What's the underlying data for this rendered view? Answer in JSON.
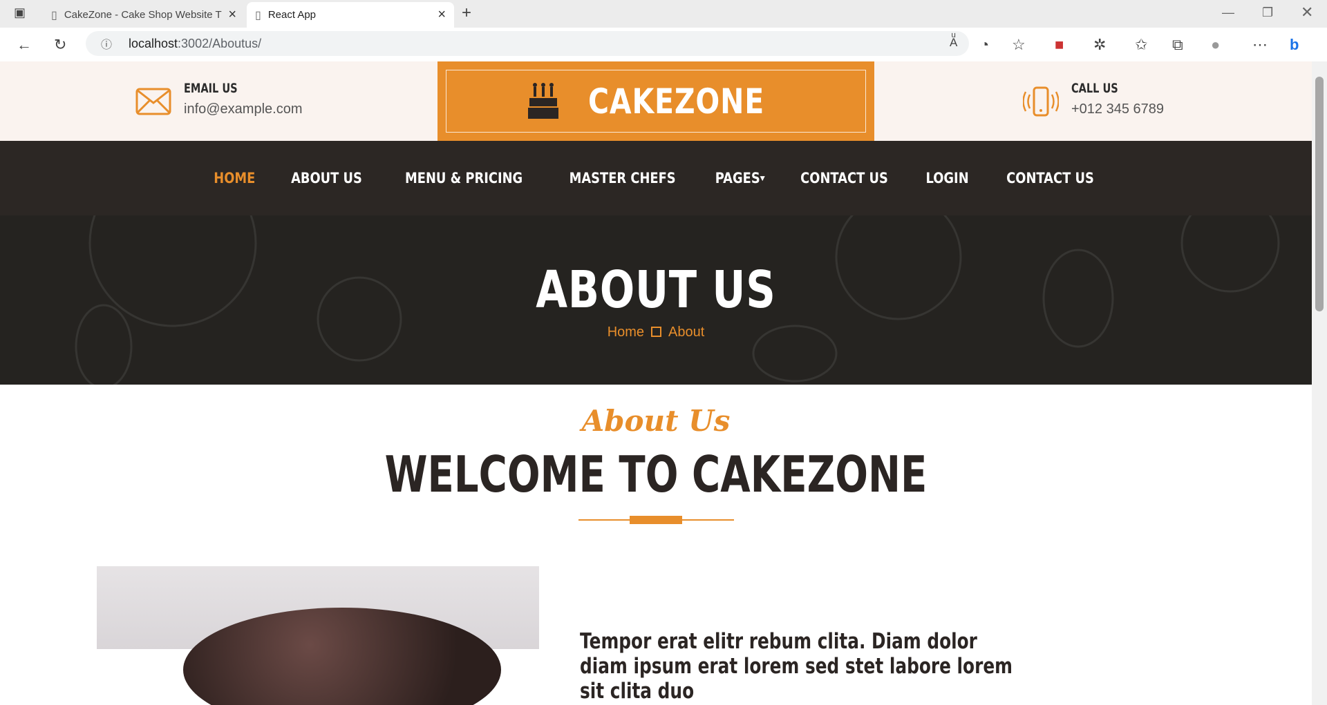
{
  "browser": {
    "tabs": [
      {
        "title": "CakeZone - Cake Shop Website T"
      },
      {
        "title": "React App"
      }
    ],
    "url_host": "localhost",
    "url_path": ":3002/Aboutus/"
  },
  "topbar": {
    "email_label": "EMAIL US",
    "email_value": "info@example.com",
    "call_label": "CALL US",
    "call_value": "+012 345 6789",
    "logo": "CAKEZONE"
  },
  "nav": {
    "items": [
      "HOME",
      "ABOUT US",
      "MENU & PRICING",
      "MASTER CHEFS",
      "PAGES",
      "CONTACT US",
      "LOGIN",
      "CONTACT US"
    ]
  },
  "hero": {
    "title": "ABOUT US",
    "crumb_home": "Home",
    "crumb_current": "About"
  },
  "about": {
    "subtitle": "About Us",
    "heading": "WELCOME TO CAKEZONE",
    "paragraph": "Tempor erat elitr rebum clita. Diam dolor diam ipsum erat lorem sed stet labore lorem sit clita duo"
  }
}
